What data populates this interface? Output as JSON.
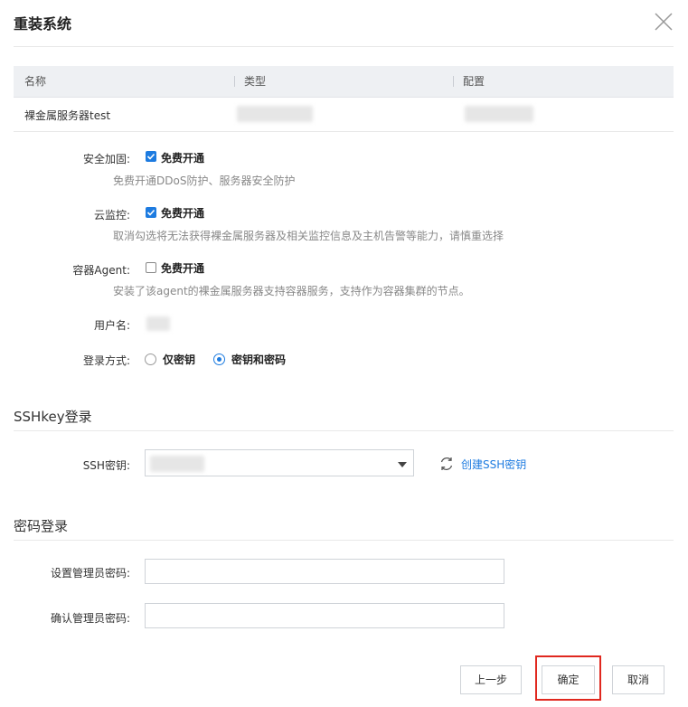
{
  "dialog": {
    "title": "重装系统",
    "close_icon": "close-icon"
  },
  "table": {
    "headers": [
      "名称",
      "类型",
      "配置"
    ],
    "rows": [
      {
        "name": "裸金属服务器test"
      }
    ]
  },
  "options": {
    "security": {
      "label": "安全加固:",
      "checkbox_label": "免费开通",
      "checked": true,
      "hint": "免费开通DDoS防护、服务器安全防护"
    },
    "monitoring": {
      "label": "云监控:",
      "checkbox_label": "免费开通",
      "checked": true,
      "hint": "取消勾选将无法获得裸金属服务器及相关监控信息及主机告警等能力，请慎重选择"
    },
    "container_agent": {
      "label": "容器Agent:",
      "checkbox_label": "免费开通",
      "checked": false,
      "hint": "安装了该agent的裸金属服务器支持容器服务，支持作为容器集群的节点。"
    },
    "username": {
      "label": "用户名:"
    },
    "login_method": {
      "label": "登录方式:",
      "choices": [
        "仅密钥",
        "密钥和密码"
      ],
      "selected": "密钥和密码"
    }
  },
  "ssh_section": {
    "title": "SSHkey登录",
    "key_label": "SSH密钥:",
    "create_link": "创建SSH密钥",
    "refresh_icon": "refresh-icon",
    "dropdown_icon": "caret-down-icon"
  },
  "password_section": {
    "title": "密码登录",
    "set_label": "设置管理员密码:",
    "confirm_label": "确认管理员密码:"
  },
  "footer": {
    "prev": "上一步",
    "confirm": "确定",
    "cancel": "取消"
  },
  "colors": {
    "accent": "#1d7be0",
    "highlight_box": "#e0281f"
  }
}
